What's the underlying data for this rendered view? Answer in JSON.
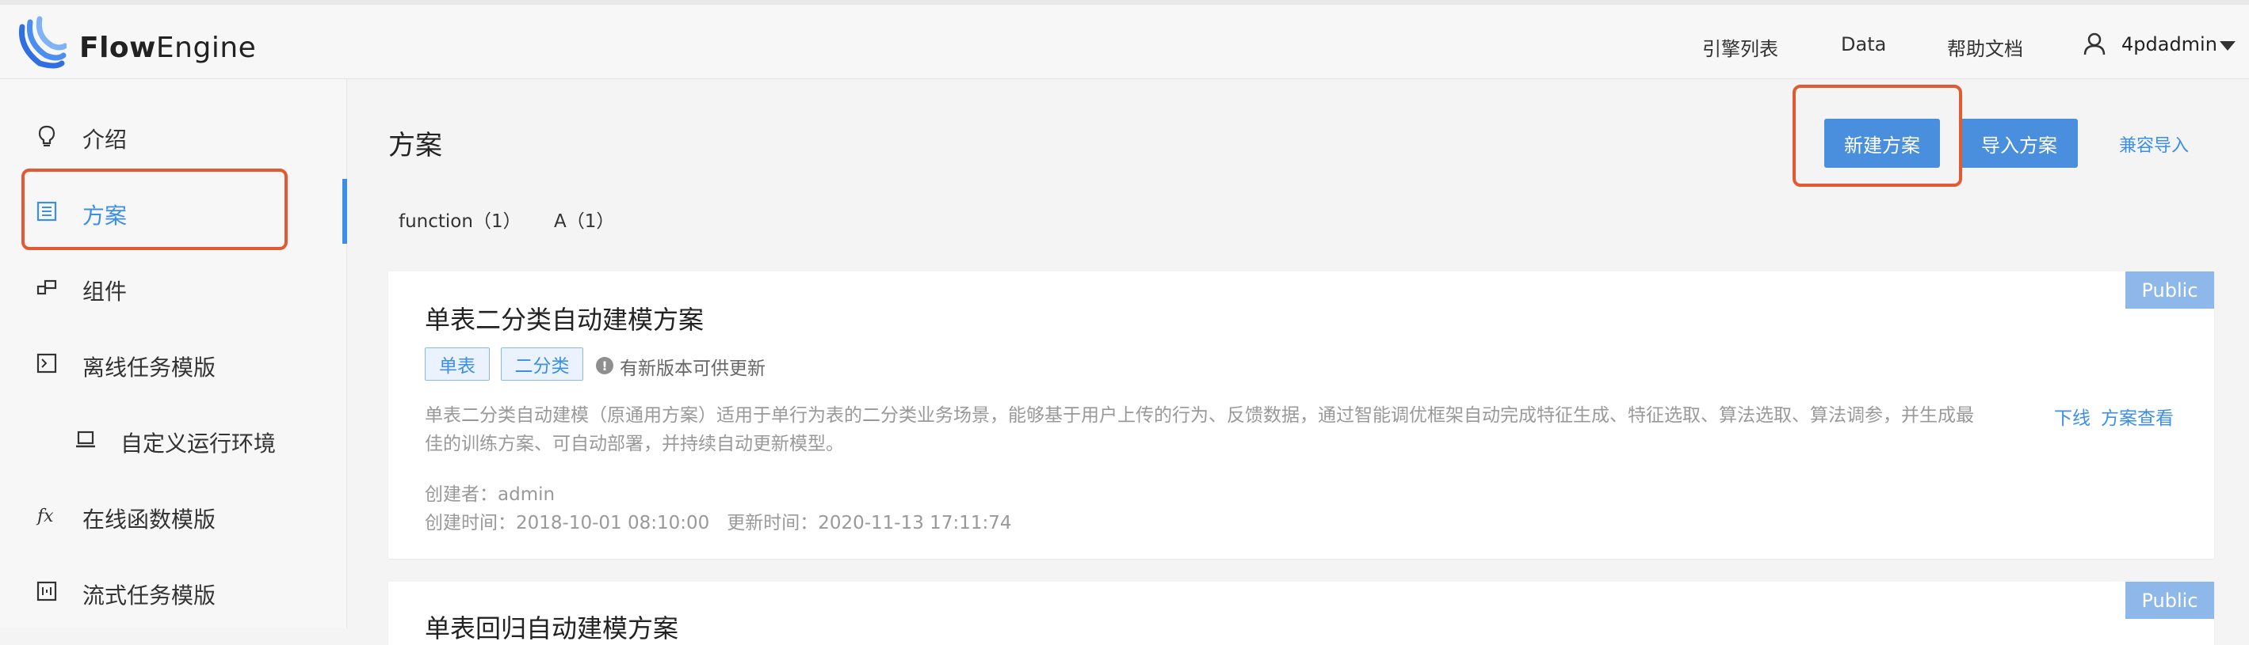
{
  "header": {
    "brand_part1": "Flow",
    "brand_part2": "Engine",
    "nav": [
      "引擎列表",
      "Data",
      "帮助文档"
    ],
    "username": "4pdadmin"
  },
  "sidebar": {
    "items": [
      {
        "label": "介绍",
        "icon": "lightbulb-icon"
      },
      {
        "label": "方案",
        "icon": "list-icon"
      },
      {
        "label": "组件",
        "icon": "component-icon"
      },
      {
        "label": "离线任务模版",
        "icon": "terminal-icon"
      },
      {
        "label": "自定义运行环境",
        "icon": "laptop-icon"
      },
      {
        "label": "在线函数模版",
        "icon": "function-icon"
      },
      {
        "label": "流式任务模版",
        "icon": "stream-icon"
      }
    ],
    "active_index": 1
  },
  "main": {
    "title": "方案",
    "buttons": {
      "new": "新建方案",
      "import": "导入方案",
      "compat_import": "兼容导入"
    },
    "filters": [
      "function（1）",
      "A（1）"
    ],
    "cards": [
      {
        "badge": "Public",
        "title": "单表二分类自动建模方案",
        "tags": [
          "单表",
          "二分类"
        ],
        "update_notice": "有新版本可供更新",
        "description": "单表二分类自动建模（原通用方案）适用于单行为表的二分类业务场景，能够基于用户上传的行为、反馈数据，通过智能调优框架自动完成特征生成、特征选取、算法选取、算法调参，并生成最佳的训练方案、可自动部署，并持续自动更新模型。",
        "creator": "创建者：admin",
        "times": "创建时间：2018-10-01 08:10:00   更新时间：2020-11-13 17:11:74",
        "actions": [
          "下线",
          "方案查看"
        ]
      },
      {
        "badge": "Public",
        "title": "单表回归自动建模方案"
      }
    ]
  },
  "colors": {
    "accent": "#3c8fe7",
    "button": "#4a8fde",
    "highlight": "#e25a32",
    "badge": "#8fb8ea"
  }
}
